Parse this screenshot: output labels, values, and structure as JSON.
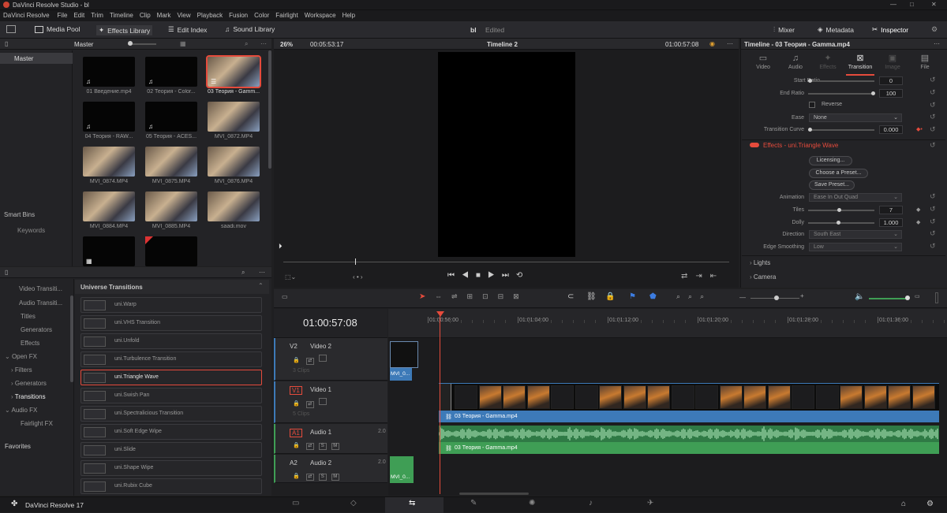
{
  "app": {
    "title": "DaVinci Resolve Studio - bl",
    "window_controls": [
      "—",
      "□",
      "✕"
    ]
  },
  "menu": [
    "DaVinci Resolve",
    "File",
    "Edit",
    "Trim",
    "Timeline",
    "Clip",
    "Mark",
    "View",
    "Playback",
    "Fusion",
    "Color",
    "Fairlight",
    "Workspace",
    "Help"
  ],
  "toolbar": {
    "media_pool": "Media Pool",
    "effects_library": "Effects Library",
    "edit_index": "Edit Index",
    "sound_library": "Sound Library",
    "project": "bl",
    "status": "Edited",
    "mixer": "Mixer",
    "metadata": "Metadata",
    "inspector": "Inspector"
  },
  "media_pool": {
    "bin": "Master",
    "sidebar_master": "Master",
    "smart_bins": "Smart Bins",
    "keywords": "Keywords",
    "clips": [
      {
        "name": "01 Введение.mp4",
        "kind": "audio"
      },
      {
        "name": "02 Теория - Color...",
        "kind": "audio"
      },
      {
        "name": "03 Теория - Gamm...",
        "kind": "video",
        "selected": true
      },
      {
        "name": "04 Теория - RAW...",
        "kind": "audio"
      },
      {
        "name": "05 Теория - ACES...",
        "kind": "audio"
      },
      {
        "name": "MVI_0872.MP4",
        "kind": "video"
      },
      {
        "name": "MVI_0874.MP4",
        "kind": "video"
      },
      {
        "name": "MVI_0875.MP4",
        "kind": "video"
      },
      {
        "name": "MVI_0876.MP4",
        "kind": "video"
      },
      {
        "name": "MVI_0884.MP4",
        "kind": "video"
      },
      {
        "name": "MVI_0885.MP4",
        "kind": "video"
      },
      {
        "name": "saadi.mov",
        "kind": "video"
      },
      {
        "name": "",
        "kind": "timeline"
      },
      {
        "name": "",
        "kind": "video"
      }
    ]
  },
  "effects": {
    "nav": [
      "Video Transiti...",
      "Audio Transiti...",
      "Titles",
      "Generators",
      "Effects",
      "Open FX",
      "Filters",
      "Generators",
      "Transitions",
      "Audio FX",
      "Fairlight FX",
      "Favorites"
    ],
    "group_title": "Universe Transitions",
    "items": [
      "uni.Warp",
      "uni.VHS Transition",
      "uni.Unfold",
      "uni.Turbulence Transition",
      "uni.Triangle Wave",
      "uni.Swish Pan",
      "uni.Spectralicious Transition",
      "uni.Soft Edge Wipe",
      "uni.Slide",
      "uni.Shape Wipe",
      "uni.Rubix Cube"
    ],
    "selected": "uni.Triangle Wave"
  },
  "viewer": {
    "zoom": "26%",
    "duration": "00:05:53:17",
    "timeline_name": "Timeline 2",
    "timecode": "01:00:57:08"
  },
  "inspector": {
    "title": "Timeline - 03 Теория - Gamma.mp4",
    "tabs": [
      "Video",
      "Audio",
      "Effects",
      "Transition",
      "Image",
      "File"
    ],
    "active_tab": "Transition",
    "start_ratio_label": "Start Ratio",
    "start_ratio": "0",
    "end_ratio_label": "End Ratio",
    "end_ratio": "100",
    "reverse_label": "Reverse",
    "ease_label": "Ease",
    "ease": "None",
    "curve_label": "Transition Curve",
    "curve": "0.000",
    "effect_title": "Effects - uni.Triangle Wave",
    "licensing": "Licensing...",
    "choose_preset": "Choose a Preset...",
    "save_preset": "Save Preset...",
    "animation_label": "Animation",
    "animation": "Ease In Out Quad",
    "tiles_label": "Tiles",
    "tiles": "7",
    "dolly_label": "Dolly",
    "dolly": "1.000",
    "direction_label": "Direction",
    "direction": "South East",
    "edge_label": "Edge Smoothing",
    "edge": "Low",
    "lights": "Lights",
    "camera": "Camera"
  },
  "timeline": {
    "timecode": "01:00:57:08",
    "ruler": [
      "01:00:56:00",
      "01:01:04:00",
      "01:01:12:00",
      "01:01:20:00",
      "01:01:28:00",
      "01:01:36:00"
    ],
    "tracks": [
      {
        "id": "V2",
        "name": "Video 2",
        "clips": "3 Clips"
      },
      {
        "id": "V1",
        "name": "Video 1",
        "clips": "5 Clips"
      },
      {
        "id": "A1",
        "name": "Audio 1",
        "level": "2.0"
      },
      {
        "id": "A2",
        "name": "Audio 2",
        "level": "2.0"
      }
    ],
    "clip_v2": "MVI_0...",
    "clip_v1": "03 Теория - Gamma.mp4",
    "clip_a1": "03 Теория - Gamma.mp4",
    "clip_a2": "MVI_0..."
  },
  "footer": {
    "app_version": "DaVinci Resolve 17"
  },
  "colors": {
    "accent": "#e64b3c",
    "video_clip": "#3d7ab8",
    "audio_clip": "#3f9e55"
  }
}
